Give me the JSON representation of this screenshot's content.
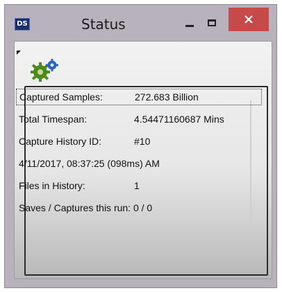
{
  "window": {
    "title": "Status",
    "app_icon_text": "DS"
  },
  "status": {
    "rows": [
      {
        "label": "Captured Samples:",
        "value": "272.683 Billion"
      },
      {
        "label": "Total Timespan:",
        "value": "4.54471160687 Mins"
      },
      {
        "label": "Capture History ID:",
        "value": "#10"
      },
      {
        "label": "4/11/2017, 08:37:25 (098ms) AM",
        "value": ""
      },
      {
        "label": "Files in History:",
        "value": "1"
      },
      {
        "label": "Saves / Captures this run: 0 / 0",
        "value": ""
      }
    ]
  },
  "colors": {
    "close_button": "#c74a4a",
    "window_frame": "#b7b2bc",
    "gear_green": "#4c8a1e",
    "gear_blue": "#2a64b8"
  },
  "icons": {
    "app": "ds-app-icon",
    "settings": "gears-icon",
    "minimize": "minimize-icon",
    "maximize": "maximize-icon",
    "close": "close-icon"
  }
}
